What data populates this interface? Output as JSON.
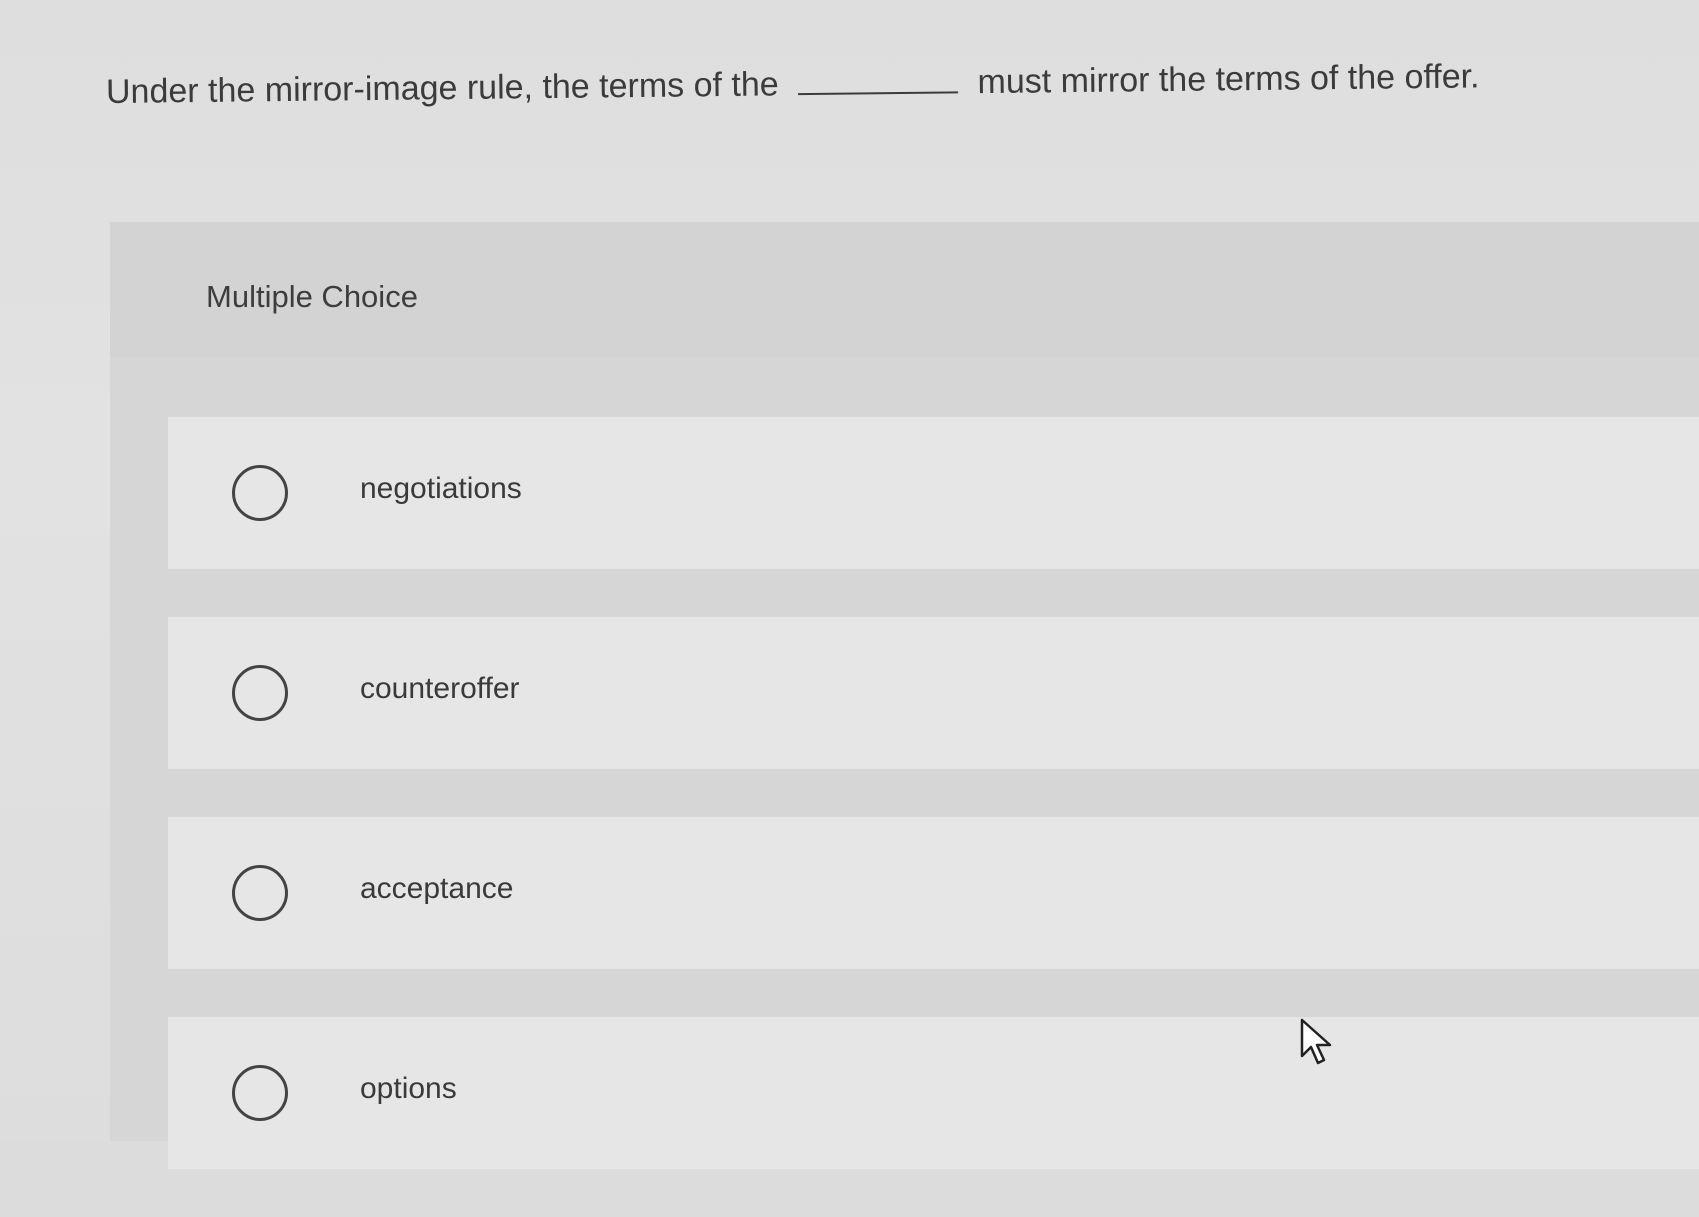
{
  "question": {
    "before_blank": "Under the mirror-image rule, the terms of the",
    "after_blank": "must mirror the terms of the offer."
  },
  "panel": {
    "heading": "Multiple Choice"
  },
  "options": [
    {
      "label": "negotiations"
    },
    {
      "label": "counteroffer"
    },
    {
      "label": "acceptance"
    },
    {
      "label": "options"
    }
  ],
  "icons": {
    "radio": "radio-unselected-icon",
    "cursor": "mouse-pointer-icon"
  }
}
